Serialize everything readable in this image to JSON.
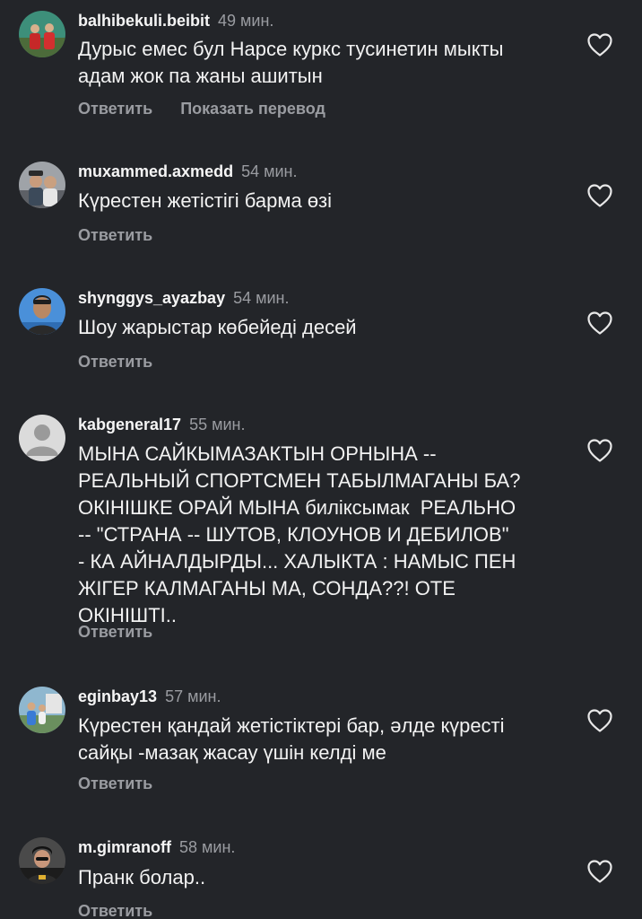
{
  "comments": [
    {
      "username": "balhibekuli.beibit",
      "time": "49 мин.",
      "text": "Дурыс емес бул Нарсе куркс тусинетин мыкты\nадам жок па жаны ашитын",
      "reply": "Ответить",
      "translate": "Показать перевод"
    },
    {
      "username": "muxammed.axmedd",
      "time": "54 мин.",
      "text": "Күрестен жетістігі барма өзі",
      "reply": "Ответить"
    },
    {
      "username": "shynggys_ayazbay",
      "time": "54 мин.",
      "text": "Шоу жарыстар көбейеді десей",
      "reply": "Ответить"
    },
    {
      "username": "kabgeneral17",
      "time": "55 мин.",
      "text": "МЫНА САЙКЫМАЗАКТЫН ОРНЫНА --\nРЕАЛЬНЫЙ СПОРТСМЕН ТАБЫЛМАГАНЫ БА?\nОКІНІШКЕ ОРАЙ МЫНА биліксымак  РЕАЛЬНО\n-- \"СТРАНА -- ШУТОВ, КЛОУНОВ И ДЕБИЛОВ\"\n- КА АЙНАЛДЫРДЫ... ХАЛЫКТА : НАМЫС ПЕН\nЖІГЕР КАЛМАГАНЫ МА, СОНДА??! ОТЕ\nОКІНІШТІ..",
      "reply": "Ответить"
    },
    {
      "username": "eginbay13",
      "time": "57 мин.",
      "text": "Күрестен қандай жетістіктері бар, әлде күресті\nсайқы -мазақ жасау үшін келді ме",
      "reply": "Ответить"
    },
    {
      "username": "m.gimranoff",
      "time": "58 мин.",
      "text": "Пранк болар..",
      "reply": "Ответить"
    }
  ],
  "icons": {
    "like": "heart-outline-icon",
    "default_avatar": "default-user-icon"
  },
  "colors": {
    "background": "#232529",
    "text": "#f2f2f2",
    "muted": "#9a9ca1"
  }
}
